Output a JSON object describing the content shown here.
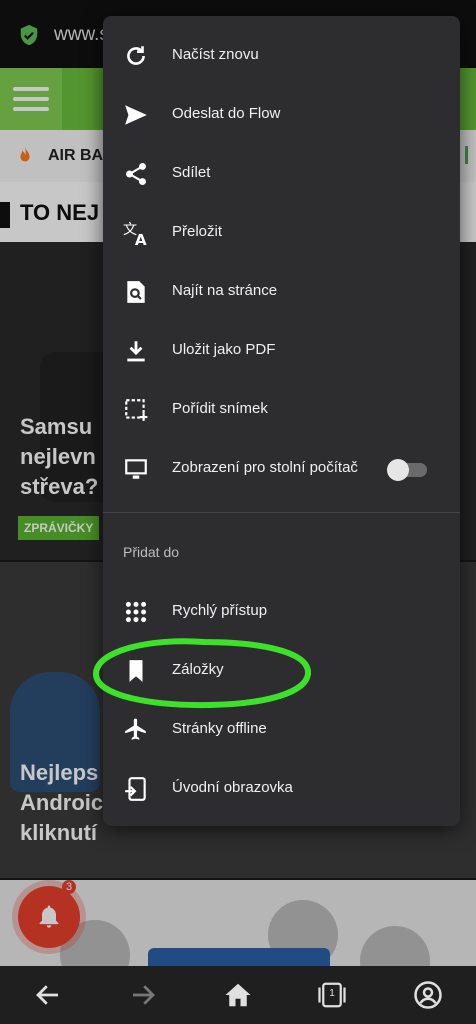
{
  "browser": {
    "url": "www.s",
    "accent_color": "#6bbf3b"
  },
  "page": {
    "ticker": "AIR BA",
    "section_title": "TO NEJ",
    "articles": [
      {
        "title": "Samsu\nnejlevn\nstřeva?",
        "badge": "ZPRÁVIČKY"
      },
      {
        "title": "Nejleps\nAndroic\nkliknutí"
      }
    ],
    "notification_count": "3"
  },
  "menu": {
    "items": [
      {
        "label": "Načíst znovu",
        "icon": "reload-icon"
      },
      {
        "label": "Odeslat do Flow",
        "icon": "send-icon"
      },
      {
        "label": "Sdílet",
        "icon": "share-icon"
      },
      {
        "label": "Přeložit",
        "icon": "translate-icon"
      },
      {
        "label": "Najít na stránce",
        "icon": "find-in-page-icon"
      },
      {
        "label": "Uložit jako PDF",
        "icon": "download-icon"
      },
      {
        "label": "Pořídit snímek",
        "icon": "screenshot-icon"
      },
      {
        "label": "Zobrazení pro stolní počítač",
        "icon": "desktop-icon",
        "toggle": false
      }
    ],
    "section_label": "Přidat do",
    "add_items": [
      {
        "label": "Rychlý přístup",
        "icon": "speed-dial-icon"
      },
      {
        "label": "Záložky",
        "icon": "bookmark-icon"
      },
      {
        "label": "Stránky offline",
        "icon": "airplane-icon"
      },
      {
        "label": "Úvodní obrazovka",
        "icon": "add-to-home-icon"
      }
    ]
  },
  "bottom_nav": {
    "tab_count": "1",
    "items": [
      "back-icon",
      "forward-icon",
      "home-icon",
      "tabs-icon",
      "account-icon"
    ]
  }
}
